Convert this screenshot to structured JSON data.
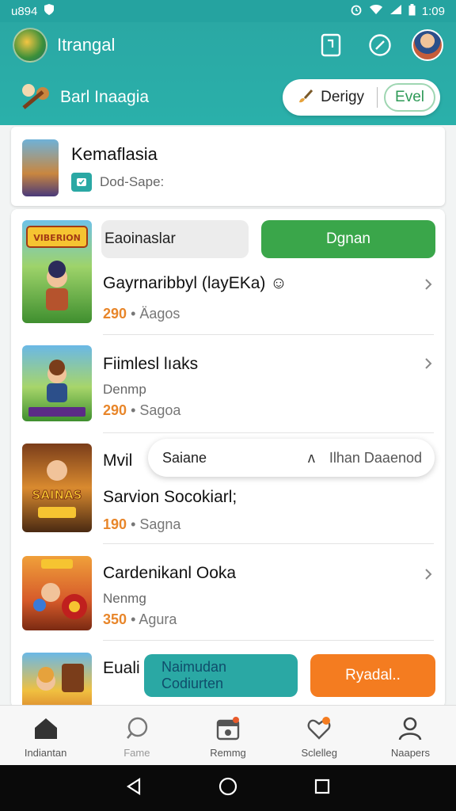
{
  "status_bar": {
    "left_text": "u894",
    "time": "1:09"
  },
  "header": {
    "app_title": "Itrangal",
    "sub_title": "Barl Inaagia"
  },
  "header_pill": {
    "label": "Derigy",
    "button": "Evel"
  },
  "featured": {
    "title": "Kemaflasia",
    "meta": "Dod-Sape:"
  },
  "list": [
    {
      "segment_label": "Eaoinaslar",
      "action_label": "Dgnan",
      "title": "Gayrnaribbyl (layEKa) ☺",
      "stat_num": "290",
      "stat_text": "• Äagos",
      "thumb_text": "VIBERION"
    },
    {
      "title": "Fiimlesl lıaks",
      "sub": "Denmp",
      "stat_num": "290",
      "stat_text": "• Sagoa"
    },
    {
      "title": "Mvil",
      "title2": "Sarvion Socokiarl;",
      "stat_num": "190",
      "stat_text": "• Sagna",
      "thumb_text": "SAINAS"
    },
    {
      "title": "Cardenikanl Ooka",
      "sub": "Nenmg",
      "stat_num": "350",
      "stat_text": "• Agura"
    },
    {
      "title": "Euali"
    }
  ],
  "popup": {
    "left": "Saiane",
    "caret": "ʌ",
    "right": "Ilhan Daaenod"
  },
  "bottom_buttons": {
    "teal_line1": "Naimudan",
    "teal_line2": "Codiurten",
    "orange": "Ryadal.."
  },
  "bottom_nav": [
    {
      "label": "Indiantan",
      "icon": "home-icon"
    },
    {
      "label": "Fame",
      "icon": "search-icon"
    },
    {
      "label": "Remmg",
      "icon": "calendar-icon"
    },
    {
      "label": "Sclelleg",
      "icon": "heart-icon"
    },
    {
      "label": "Naapers",
      "icon": "profile-icon"
    }
  ],
  "colors": {
    "teal": "#2aa8a4",
    "green": "#3aa64a",
    "orange": "#f47c20",
    "stat_orange": "#e8862a"
  }
}
